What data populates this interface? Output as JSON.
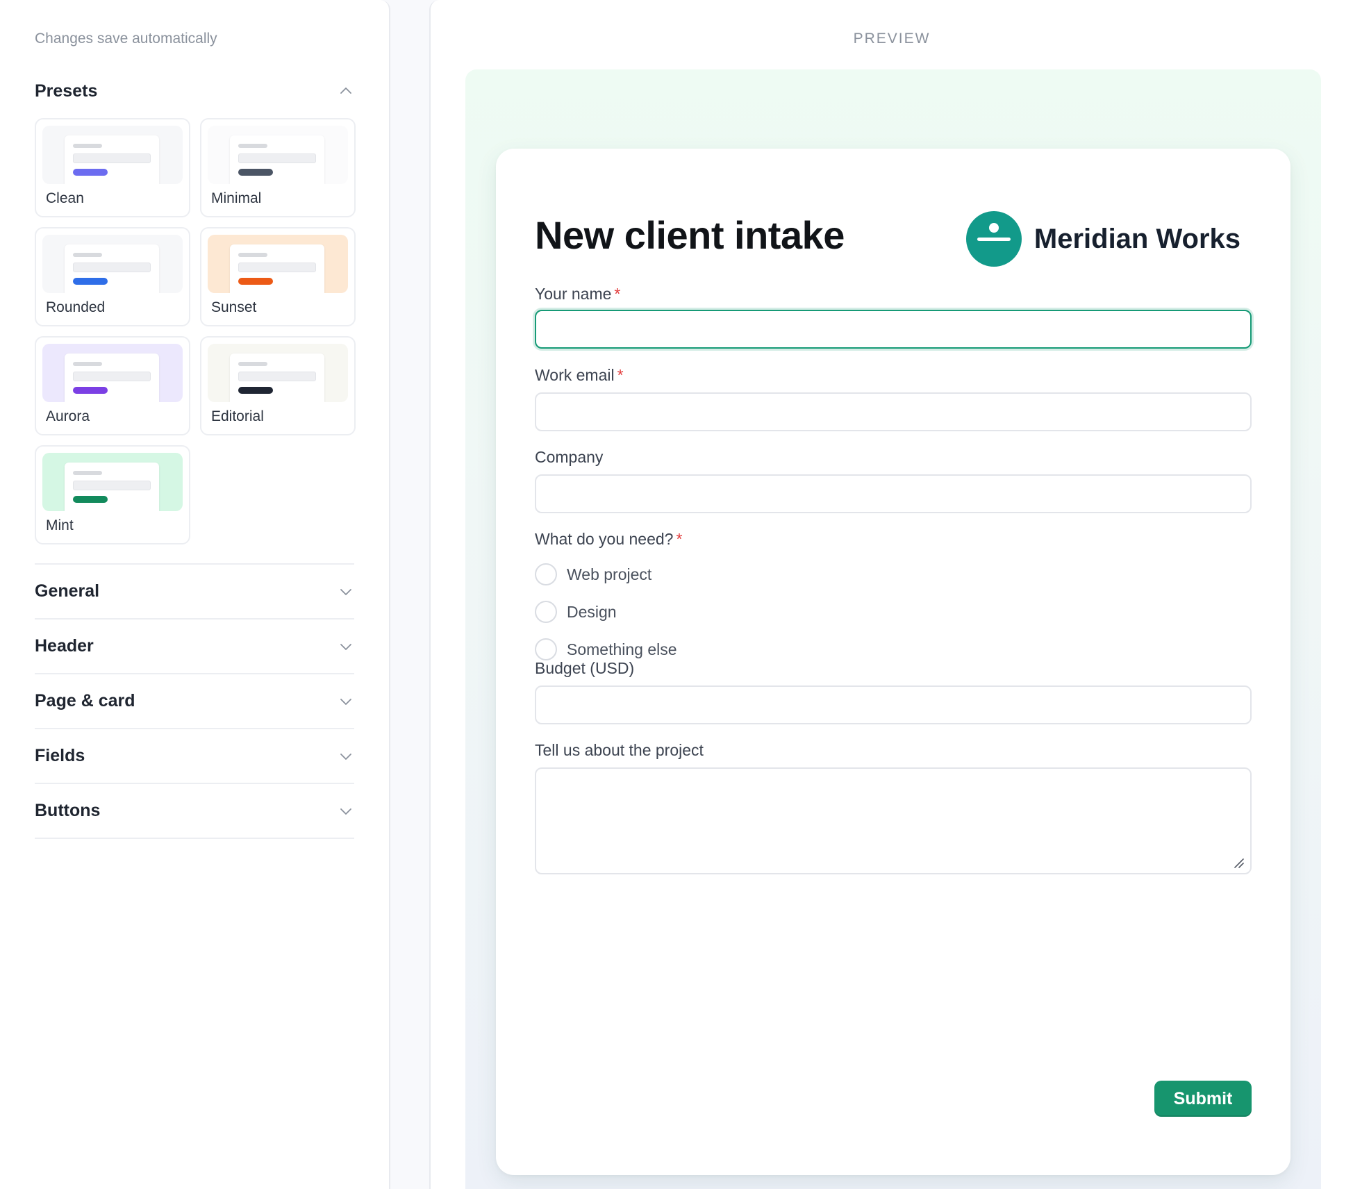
{
  "sidebar": {
    "autosave_text": "Changes save automatically",
    "presets": {
      "title": "Presets",
      "items": [
        {
          "label": "Clean",
          "bg": "#f6f7f9",
          "accent": "#6c6cf0"
        },
        {
          "label": "Minimal",
          "bg": "#fbfbfc",
          "accent": "#4b5565"
        },
        {
          "label": "Rounded",
          "bg": "#f6f7f9",
          "accent": "#2f6ee8"
        },
        {
          "label": "Sunset",
          "bg": "#fde8d3",
          "accent": "#ec5a16"
        },
        {
          "label": "Aurora",
          "bg": "#ece8fd",
          "accent": "#7b3fe4"
        },
        {
          "label": "Editorial",
          "bg": "#f7f7f2",
          "accent": "#1f2533"
        },
        {
          "label": "Mint",
          "bg": "#d5f7e4",
          "accent": "#128a5c"
        }
      ]
    },
    "sections": [
      "General",
      "Header",
      "Page & card",
      "Fields",
      "Buttons"
    ]
  },
  "preview": {
    "label": "PREVIEW",
    "form": {
      "title": "New client intake",
      "brand_name": "Meridian Works",
      "brand_color": "#129a8a",
      "fields": {
        "name_label": "Your name",
        "email_label": "Work email",
        "company_label": "Company",
        "need_label": "What do you need?",
        "budget_label": "Budget (USD)",
        "about_label": "Tell us about the project",
        "required_mark": "*"
      },
      "need_options": [
        "Web project",
        "Design",
        "Something else"
      ],
      "submit_label": "Submit"
    }
  }
}
